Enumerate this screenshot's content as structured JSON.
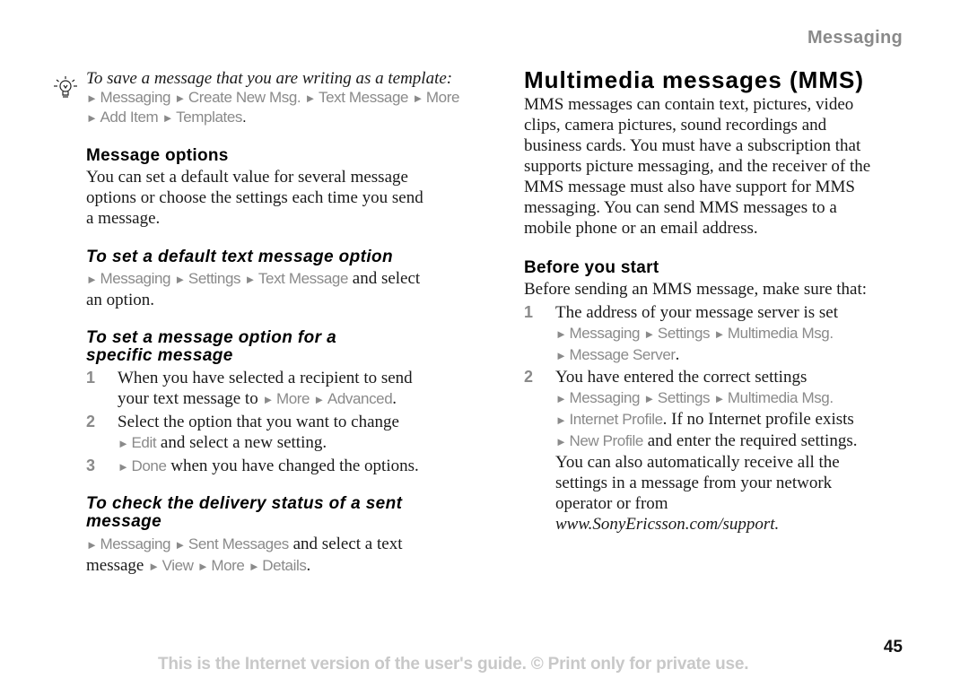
{
  "header": {
    "section_label": "Messaging"
  },
  "tip": {
    "icon": "lightbulb-icon",
    "text": "To save a message that you are writing as a template:",
    "path_line1": [
      "Messaging",
      "Create New Msg.",
      "Text Message",
      "More"
    ],
    "path_line2": [
      "Add Item",
      "Templates"
    ]
  },
  "left": {
    "message_options": {
      "heading": "Message options",
      "body_lines": [
        "You can set a default value for several message",
        "options or choose the settings each time you send",
        "a message."
      ]
    },
    "default_option": {
      "heading": "To set a default text message option",
      "path": [
        "Messaging",
        "Settings",
        "Text Message"
      ],
      "after": "and select",
      "line2": "an option."
    },
    "specific_option": {
      "heading_lines": [
        "To set a message option for a",
        "specific message"
      ],
      "steps": [
        {
          "num": "1",
          "line1": "When you have selected a recipient to send",
          "line2_prefix": "your text message to",
          "line2_path": [
            "More",
            "Advanced"
          ]
        },
        {
          "num": "2",
          "line1": "Select the option that you want to change",
          "line2_path": [
            "Edit"
          ],
          "line2_suffix": "and select a new setting."
        },
        {
          "num": "3",
          "line1_path": [
            "Done"
          ],
          "line1_suffix": "when you have changed the options."
        }
      ]
    },
    "delivery_status": {
      "heading_lines": [
        "To check the delivery status of a sent",
        "message"
      ],
      "path1": [
        "Messaging",
        "Sent Messages"
      ],
      "after1": "and select a text",
      "prefix2": "message",
      "path2": [
        "View",
        "More",
        "Details"
      ]
    }
  },
  "right": {
    "title": "Multimedia messages (MMS)",
    "intro_lines": [
      "MMS messages can contain text, pictures, video",
      "clips, camera pictures, sound recordings and",
      "business cards. You must have a subscription that",
      "supports picture messaging, and the receiver of the",
      "MMS message must also have support for MMS",
      "messaging. You can send MMS messages to a",
      "mobile phone or an email address."
    ],
    "before": {
      "heading": "Before you start",
      "lead": "Before sending an MMS message, make sure that:",
      "steps": [
        {
          "num": "1",
          "line1": "The address of your message server is set",
          "path_a": [
            "Messaging",
            "Settings",
            "Multimedia Msg."
          ],
          "path_b": [
            "Message Server"
          ]
        },
        {
          "num": "2",
          "line1": "You have entered the correct settings",
          "path_a": [
            "Messaging",
            "Settings",
            "Multimedia Msg."
          ],
          "path_b": [
            "Internet Profile"
          ],
          "path_b_suffix": "If no Internet profile exists",
          "path_c": [
            "New Profile"
          ],
          "path_c_suffix": "and enter the required settings.",
          "extra_lines": [
            "You can also automatically receive all the",
            "settings in a message from your network",
            "operator or from"
          ],
          "url": "www.SonyEricsson.com/support."
        }
      ]
    }
  },
  "footer": {
    "page_number": "45",
    "notice": "This is the Internet version of the user's guide. © Print only for private use."
  }
}
